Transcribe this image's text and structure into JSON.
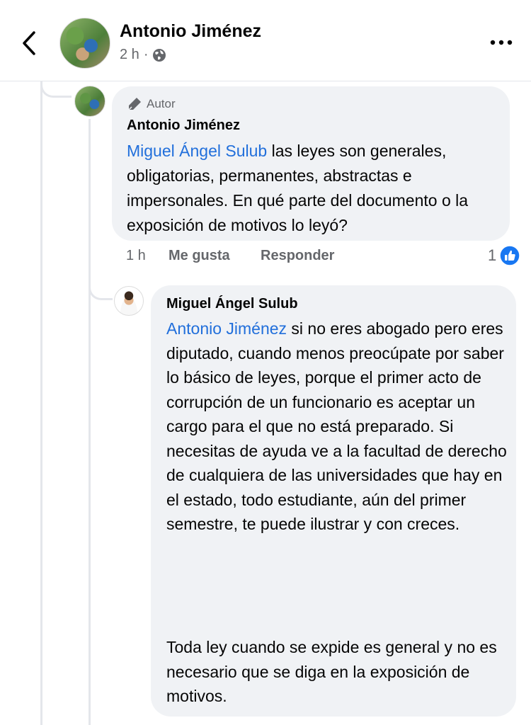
{
  "header": {
    "title": "Antonio Jiménez",
    "time": "2 h",
    "separator": "·"
  },
  "comment1": {
    "badge": "Autor",
    "author": "Antonio Jiménez",
    "mention": "Miguel Ángel Sulub",
    "text": " las leyes son generales, obligatorias, permanentes, abstractas e impersonales. En qué parte del documento o la exposición de motivos lo leyó?",
    "time": "1 h",
    "like_label": "Me gusta",
    "reply_label": "Responder",
    "reaction_count": "1"
  },
  "comment2": {
    "author": "Miguel Ángel Sulub",
    "mention": "Antonio Jiménez",
    "text": " si no eres abogado pero eres diputado, cuando menos preocúpate por saber lo básico de leyes, porque el primer acto de corrupción de un funcionario es aceptar un cargo para el que no está preparado. Si necesitas de ayuda ve a la facultad de derecho de cualquiera de las  universidades que hay en el estado, todo estudiante, aún del primer semestre, te puede ilustrar y con creces.",
    "text2": "Toda ley cuando se expide es general y no es necesario que se diga en la exposición de motivos."
  },
  "colors": {
    "mention": "#216fdb",
    "bubble": "#f0f2f5",
    "meta": "#65676b",
    "like_blue": "#1877f2"
  },
  "icons": {
    "back": "chevron-left-icon",
    "globe": "globe-icon",
    "more": "more-dots-icon",
    "author_badge": "pen-icon",
    "reaction": "like-reaction-icon"
  }
}
